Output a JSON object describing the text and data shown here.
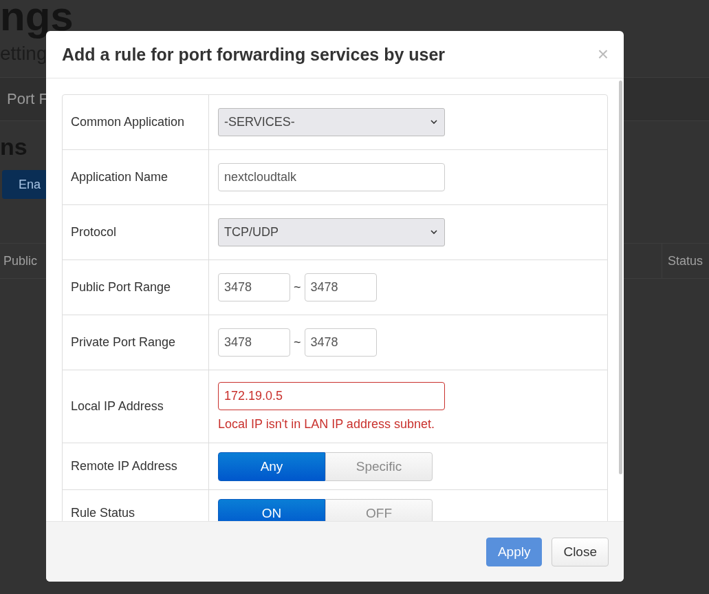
{
  "background": {
    "heading": "ngs",
    "subtitle": "etting",
    "tab": "Port F",
    "section_title": "ns",
    "button": "Ena",
    "columns": [
      "Public",
      "Status"
    ]
  },
  "dialog": {
    "title": "Add a rule for port forwarding services by user",
    "close": "×",
    "rows": [
      {
        "kind": "select",
        "label": "Common Application",
        "value": "-SERVICES-"
      },
      {
        "kind": "text",
        "label": "Application Name",
        "value": "nextcloudtalk"
      },
      {
        "kind": "select",
        "label": "Protocol",
        "value": "TCP/UDP"
      },
      {
        "kind": "range",
        "label": "Public Port Range",
        "from": "3478",
        "separator": "~",
        "to": "3478"
      },
      {
        "kind": "range",
        "label": "Private Port Range",
        "from": "3478",
        "separator": "~",
        "to": "3478"
      },
      {
        "kind": "text",
        "label": "Local IP Address",
        "value": "172.19.0.5",
        "error": "Local IP isn't in LAN IP address subnet."
      },
      {
        "kind": "toggle",
        "label": "Remote IP Address",
        "options": [
          {
            "label": "Any",
            "selected": true
          },
          {
            "label": "Specific",
            "selected": false
          }
        ]
      },
      {
        "kind": "toggle",
        "label": "Rule Status",
        "options": [
          {
            "label": "ON",
            "selected": true
          },
          {
            "label": "OFF",
            "selected": false
          }
        ]
      }
    ],
    "buttons": [
      {
        "label": "Apply",
        "kind": "primary"
      },
      {
        "label": "Close",
        "kind": "default"
      }
    ]
  }
}
